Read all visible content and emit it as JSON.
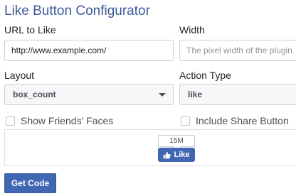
{
  "title": "Like Button Configurator",
  "url_field": {
    "label": "URL to Like",
    "value": "http://www.example.com/"
  },
  "width_field": {
    "label": "Width",
    "placeholder": "The pixel width of the plugin"
  },
  "layout_field": {
    "label": "Layout",
    "selected": "box_count"
  },
  "action_field": {
    "label": "Action Type",
    "selected": "like"
  },
  "checkboxes": {
    "show_faces": {
      "label": "Show Friends' Faces",
      "checked": false
    },
    "share_button": {
      "label": "Include Share Button",
      "checked": false
    }
  },
  "preview": {
    "count": "15M",
    "like_label": "Like"
  },
  "get_code_label": "Get Code",
  "colors": {
    "title": "#3b5998",
    "button": "#4267b2"
  }
}
